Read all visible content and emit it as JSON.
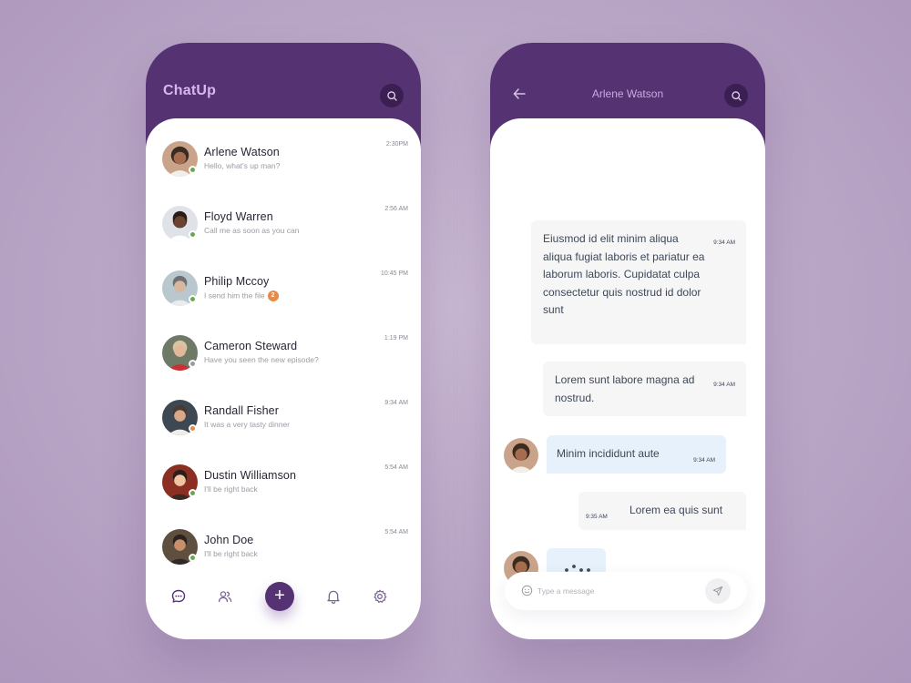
{
  "list_screen": {
    "app_title": "ChatUp",
    "contacts": [
      {
        "name": "Arlene Watson",
        "message": "Hello, what's up man?",
        "time": "2:30PM",
        "status_color": "#6aa84f"
      },
      {
        "name": "Floyd Warren",
        "message": "Call me as soon as you can",
        "time": "2:56 AM",
        "status_color": "#6aa84f"
      },
      {
        "name": "Philip Mccoy",
        "message": "I send him the file",
        "time": "10:45 PM",
        "status_color": "#6aa84f",
        "unread": "2"
      },
      {
        "name": "Cameron Steward",
        "message": "Have you seen the new episode?",
        "time": "1:19 PM",
        "status_color": "#9a9aa3"
      },
      {
        "name": "Randall Fisher",
        "message": "It was a very tasty dinner",
        "time": "9:34 AM",
        "status_color": "#e68a45"
      },
      {
        "name": "Dustin Williamson",
        "message": "I'll be right back",
        "time": "5:54 AM",
        "status_color": "#6aa84f"
      },
      {
        "name": "John Doe",
        "message": "I'll be right back",
        "time": "5:54 AM",
        "status_color": "#6aa84f"
      }
    ],
    "nav": {
      "chats_icon": "chat-bubble-icon",
      "contacts_icon": "users-icon",
      "add_icon": "plus-icon",
      "notifications_icon": "bell-icon",
      "settings_icon": "gear-icon",
      "add_label": "+"
    }
  },
  "chat_screen": {
    "title": "Arlene Watson",
    "messages": [
      {
        "direction": "out",
        "text": "Eiusmod id elit minim aliqua aliqua fugiat laboris et pariatur ea laborum laboris. Cupidatat culpa consectetur quis nostrud id dolor sunt",
        "time": "9:34 AM"
      },
      {
        "direction": "out",
        "text": "Lorem sunt labore magna ad nostrud.",
        "time": "9:34 AM"
      },
      {
        "direction": "in",
        "text": "Minim incididunt aute",
        "time": "9:34 AM"
      },
      {
        "direction": "out",
        "text": "Lorem ea quis sunt",
        "time": "9:35 AM"
      },
      {
        "direction": "in",
        "typing": true
      }
    ],
    "composer_placeholder": "Type a message"
  },
  "colors": {
    "header_purple": "#553272",
    "title_lilac": "#d7b8ec",
    "incoming_bubble": "#e6f1fb",
    "outgoing_bubble": "#f6f6f7",
    "unread_orange": "#e68a45"
  }
}
